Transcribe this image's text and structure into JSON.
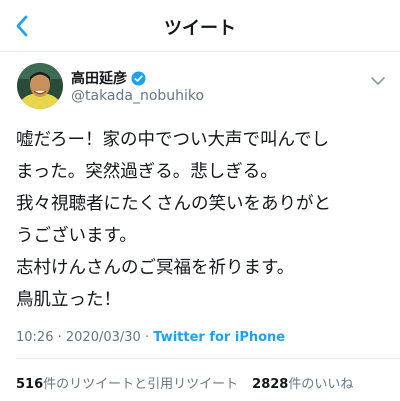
{
  "nav": {
    "title": "ツイート",
    "back_icon": "chevron-left-icon"
  },
  "tweet": {
    "author_name": "高田延彦",
    "verified": true,
    "handle": "@takada_nobuhiko",
    "lines": [
      "嘘だろー！家の中でつい大声で叫んでし",
      "まった。突然過ぎる。悲しぎる。",
      "我々視聴者にたくさんの笑いをありがと",
      "うございます。",
      "志村けんさんのご冥福を祈ります。",
      "鳥肌立った！"
    ],
    "time": "10:26",
    "date": "2020/03/30",
    "separator": "·",
    "app": "Twitter for iPhone"
  },
  "stats": {
    "retweets_count": "516",
    "retweets_label": "件のリツイートと引用リツイート",
    "likes_count": "2828",
    "likes_label": "件のいいね"
  },
  "colors": {
    "accent": "#1da1f2",
    "text": "#14171a",
    "secondary": "#657786",
    "divider": "#e6ecf0"
  }
}
